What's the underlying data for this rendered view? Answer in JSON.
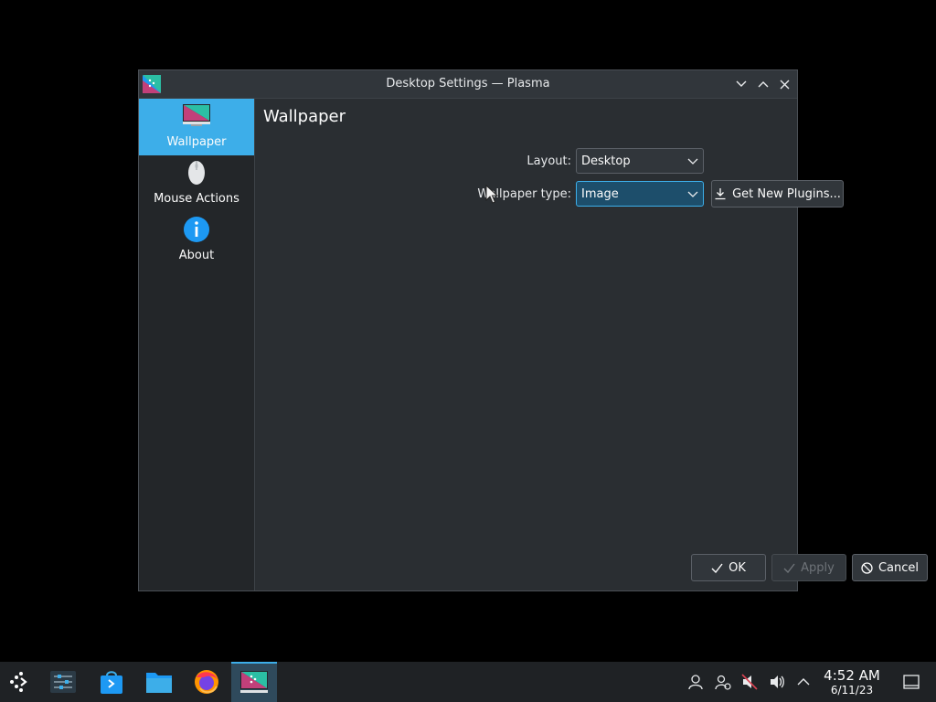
{
  "window": {
    "title": "Desktop Settings — Plasma"
  },
  "sidebar": {
    "items": [
      {
        "label": "Wallpaper",
        "icon": "monitor-icon",
        "active": true
      },
      {
        "label": "Mouse Actions",
        "icon": "mouse-icon",
        "active": false
      },
      {
        "label": "About",
        "icon": "info-icon",
        "active": false
      }
    ]
  },
  "main": {
    "title": "Wallpaper",
    "layout_label": "Layout:",
    "layout_value": "Desktop",
    "wallpaper_type_label": "Wallpaper type:",
    "wallpaper_type_value": "Image",
    "get_plugins_label": "Get New Plugins..."
  },
  "footer": {
    "ok_label": "OK",
    "apply_label": "Apply",
    "cancel_label": "Cancel"
  },
  "taskbar": {
    "apps": [
      "application-launcher-icon",
      "settings-sliders-icon",
      "discover-store-icon",
      "file-manager-icon",
      "firefox-icon",
      "desktop-settings-icon"
    ],
    "tray": [
      "user-icon",
      "network-icon",
      "audio-muted-icon",
      "volume-icon",
      "tray-expand-icon"
    ],
    "clock": {
      "time": "4:52 AM",
      "date": "6/11/23"
    }
  },
  "colors": {
    "accent": "#3daee9",
    "window_bg": "#2a2e32",
    "sidebar_bg": "#232629",
    "desktop_bg": "#000000"
  }
}
